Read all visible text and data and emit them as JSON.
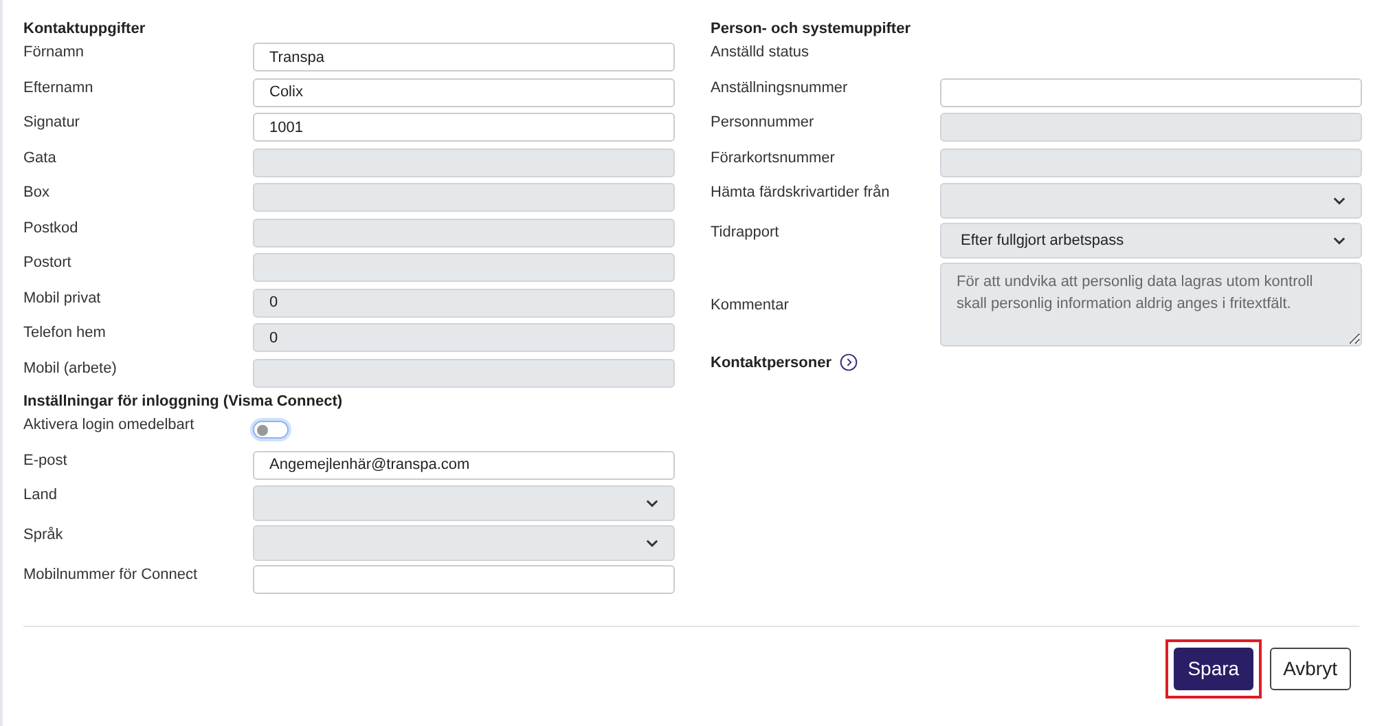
{
  "left_sections": [
    {
      "title": "Kontaktuppgifter",
      "fields": [
        {
          "label": "Förnamn",
          "kind": "text",
          "value": "Transpa",
          "disabled": false
        },
        {
          "label": "Efternamn",
          "kind": "text",
          "value": "Colix",
          "disabled": false
        },
        {
          "label": "Signatur",
          "kind": "text",
          "value": "1001",
          "disabled": false
        },
        {
          "label": "Gata",
          "kind": "text",
          "disabled": true
        },
        {
          "label": "Box",
          "kind": "text",
          "disabled": true
        },
        {
          "label": "Postkod",
          "kind": "text",
          "disabled": true
        },
        {
          "label": "Postort",
          "kind": "text",
          "disabled": true
        },
        {
          "label": "Mobil privat",
          "kind": "text",
          "value": "0",
          "disabled": true
        },
        {
          "label": "Telefon hem",
          "kind": "text",
          "value": "0",
          "disabled": true
        },
        {
          "label": "Mobil (arbete)",
          "kind": "text",
          "disabled": true
        }
      ]
    },
    {
      "title": "Inställningar för inloggning (Visma Connect)",
      "fields": [
        {
          "label": "Aktivera login omedelbart",
          "kind": "toggle",
          "on": false
        },
        {
          "label": "E-post",
          "kind": "text",
          "value": "Angemejlenhär@transpa.com",
          "disabled": false
        },
        {
          "label": "Land",
          "kind": "select",
          "disabled": true
        },
        {
          "label": "Språk",
          "kind": "select",
          "disabled": true
        },
        {
          "label": "Mobilnummer för Connect",
          "kind": "text",
          "disabled": false
        }
      ]
    }
  ],
  "right_section": {
    "title": "Person- och systemuppifter",
    "fields": [
      {
        "label": "Anställd status",
        "kind": "none"
      },
      {
        "label": "Anställningsnummer",
        "kind": "text",
        "disabled": false
      },
      {
        "label": "Personnummer",
        "kind": "text",
        "disabled": true
      },
      {
        "label": "Förarkortsnummer",
        "kind": "text",
        "disabled": true
      },
      {
        "label": "Hämta färdskrivartider från",
        "kind": "select",
        "disabled": true
      },
      {
        "label": "Tidrapport",
        "kind": "select",
        "value": "Efter fullgjort arbetspass",
        "disabled": true
      },
      {
        "label": "Kommentar",
        "kind": "textarea",
        "placeholder": "För att undvika att personlig data lagras utom kontroll skall personlig information aldrig anges i fritextfält.",
        "disabled": true
      }
    ],
    "link": "Kontaktpersoner"
  },
  "buttons": [
    {
      "label": "Spara",
      "kind": "primary",
      "highlighted": true
    },
    {
      "label": "Avbryt",
      "kind": "secondary",
      "highlighted": false
    }
  ]
}
